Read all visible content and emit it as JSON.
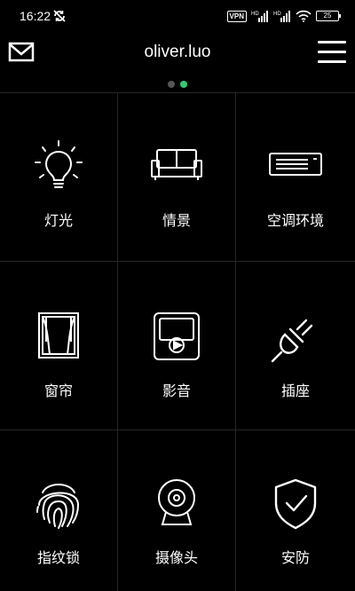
{
  "status_bar": {
    "time": "16:22",
    "vpn": "VPN",
    "battery": "25"
  },
  "header": {
    "title": "oliver.luo",
    "mail_icon": "mail-icon",
    "menu_icon": "hamburger-menu-icon"
  },
  "pager": {
    "pages": 2,
    "active_index": 1,
    "active_color": "#2ecc71",
    "inactive_color": "#555555"
  },
  "tiles": [
    {
      "label": "灯光",
      "icon": "light-bulb-icon"
    },
    {
      "label": "情景",
      "icon": "sofa-icon"
    },
    {
      "label": "空调环境",
      "icon": "air-conditioner-icon"
    },
    {
      "label": "窗帘",
      "icon": "curtain-icon"
    },
    {
      "label": "影音",
      "icon": "media-player-icon"
    },
    {
      "label": "插座",
      "icon": "plug-icon"
    },
    {
      "label": "指纹锁",
      "icon": "fingerprint-icon"
    },
    {
      "label": "摄像头",
      "icon": "camera-icon"
    },
    {
      "label": "安防",
      "icon": "shield-check-icon"
    }
  ]
}
